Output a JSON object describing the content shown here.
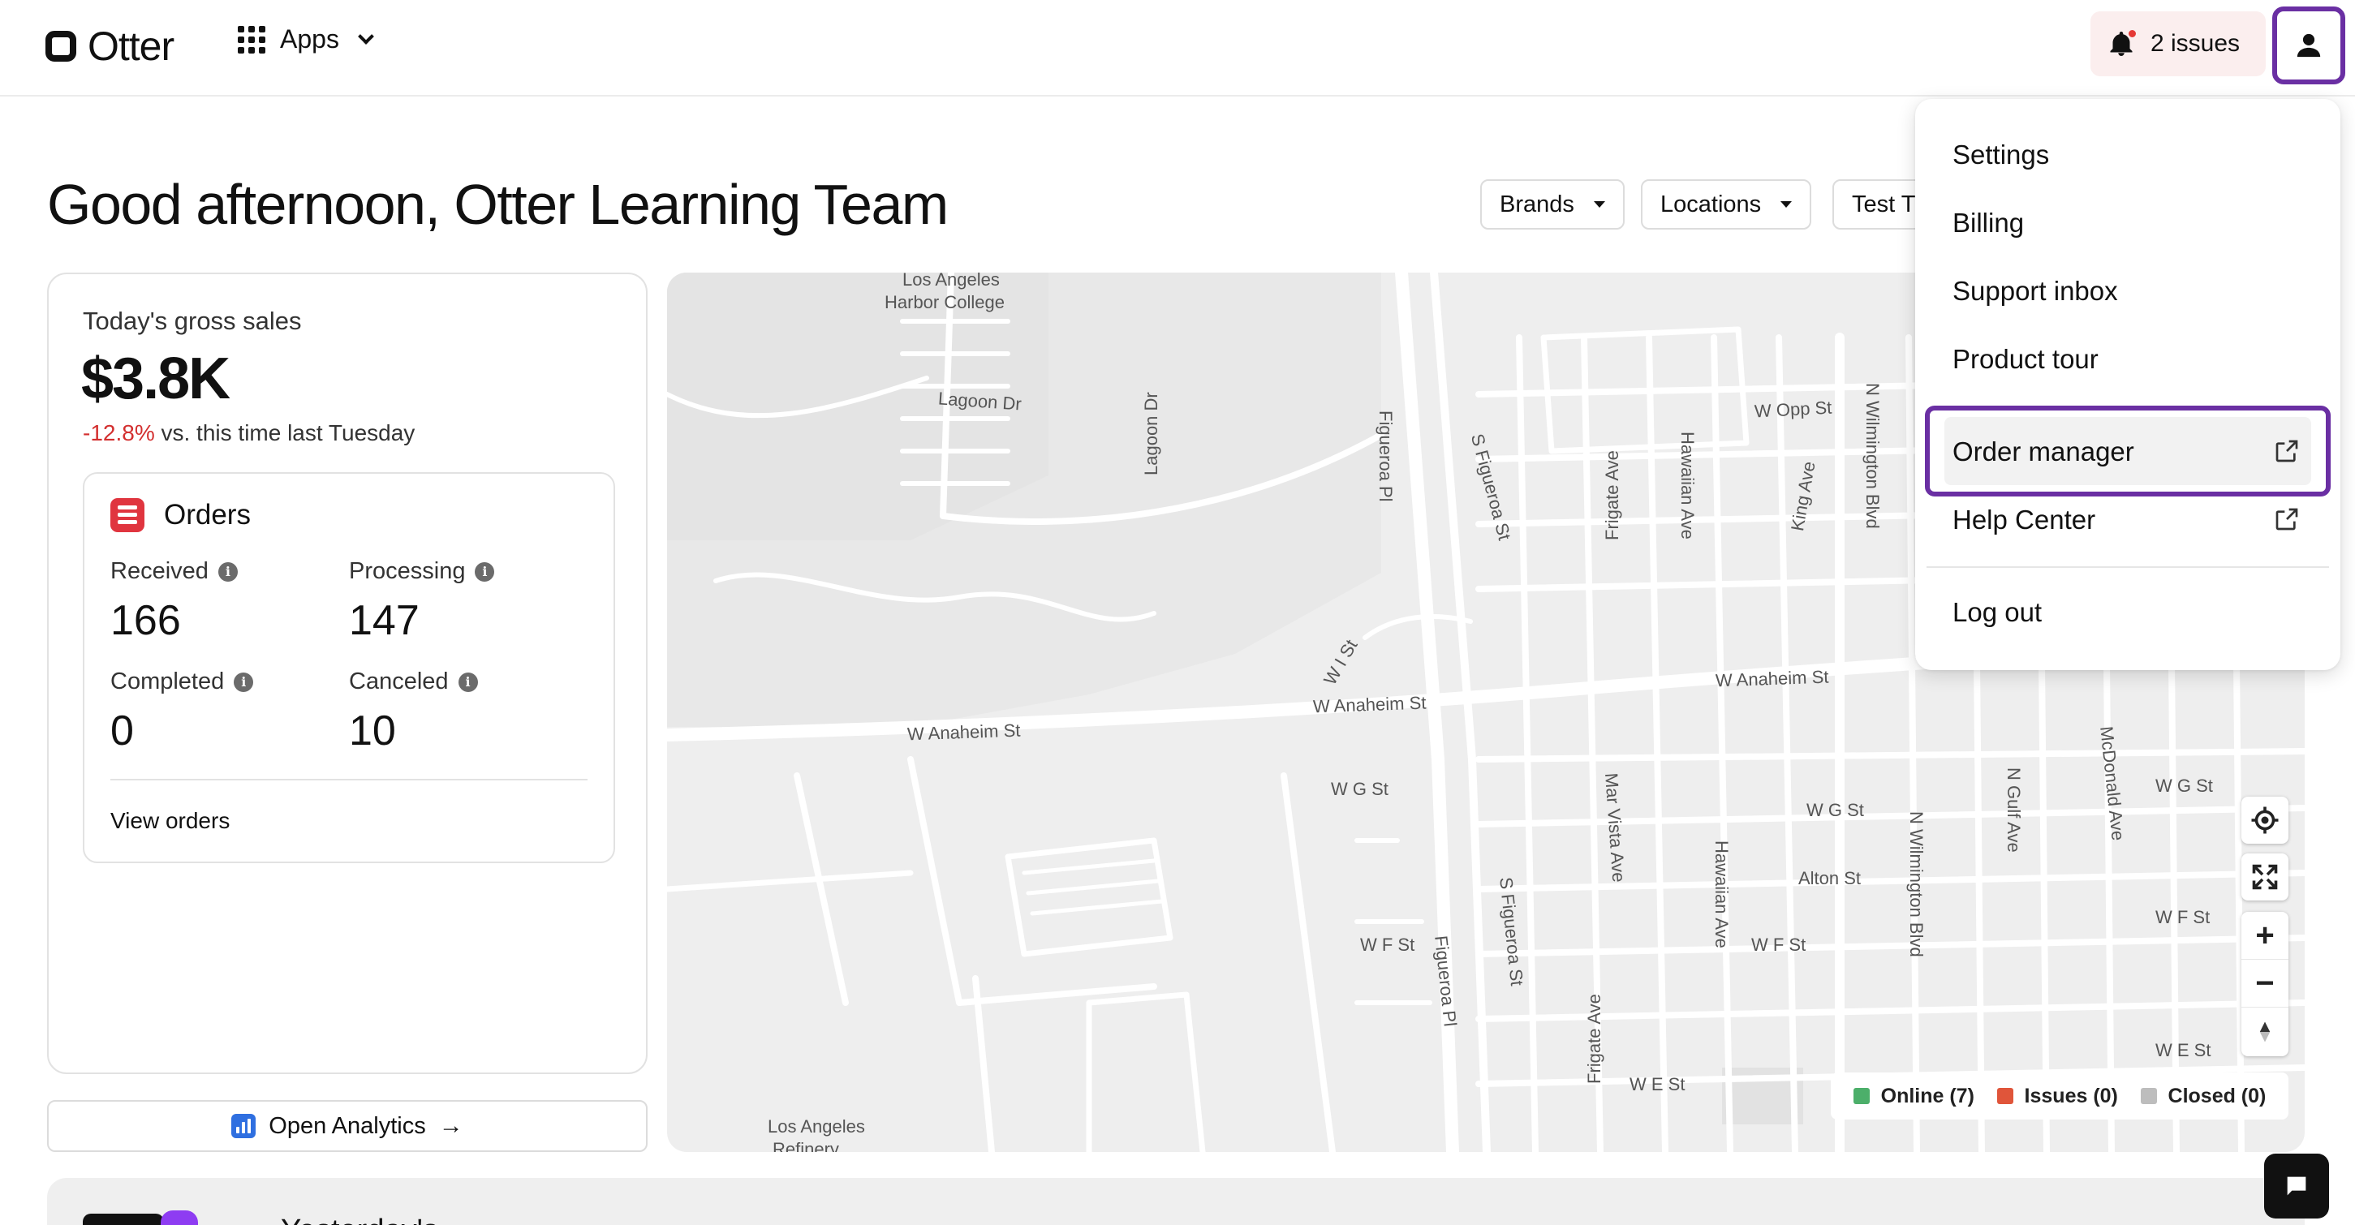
{
  "header": {
    "logo_text": "Otter",
    "apps_label": "Apps",
    "issues_label": "2 issues"
  },
  "greeting": "Good afternoon, Otter Learning Team",
  "filters": {
    "brands": "Brands",
    "locations": "Locations",
    "test": "Test T"
  },
  "sales": {
    "label": "Today's gross sales",
    "value": "$3.8K",
    "delta": "-12.8%",
    "delta_suffix": "vs. this time last Tuesday"
  },
  "orders": {
    "title": "Orders",
    "received_label": "Received",
    "received_value": "166",
    "processing_label": "Processing",
    "processing_value": "147",
    "completed_label": "Completed",
    "completed_value": "0",
    "canceled_label": "Canceled",
    "canceled_value": "10",
    "view_orders": "View orders"
  },
  "analytics": {
    "label": "Open Analytics"
  },
  "map": {
    "labels": {
      "la_harbor_1": "Los Angeles",
      "la_harbor_2": "Harbor College",
      "lagoon_dr": "Lagoon Dr",
      "lagoon_dr_v": "Lagoon Dr",
      "figueroa_pl": "Figueroa Pl",
      "s_figueroa_st": "S Figueroa St",
      "frigate_ave": "Frigate Ave",
      "hawaiian_ave": "Hawaiian Ave",
      "king_ave": "King Ave",
      "w_opp_st": "W Opp St",
      "n_wilmington": "N Wilmington Blvd",
      "w_i_st": "W I St",
      "w_anaheim_1": "W Anaheim St",
      "w_anaheim_2": "W Anaheim St",
      "w_anaheim_3": "W Anaheim St",
      "w_g_st_1": "W G St",
      "w_g_st_2": "W G St",
      "w_g_st_3": "W G St",
      "mar_vista": "Mar Vista Ave",
      "hawaiian_ave_2": "Hawaiian Ave",
      "n_wilmington_2": "N Wilmington Blvd",
      "n_gulf": "N Gulf Ave",
      "mcdonald": "McDonald Ave",
      "alton_st": "Alton St",
      "w_f_st_1": "W F St",
      "w_f_st_2": "W F St",
      "w_f_st_3": "W F St",
      "figueroa_pl_2": "Figueroa Pl",
      "s_figueroa_2": "S Figueroa St",
      "frigate_ave_2": "Frigate Ave",
      "w_e_st_1": "W E St",
      "w_e_st_2": "W E St",
      "la_refinery_1": "Los Angeles",
      "la_refinery_2": "Refinery"
    },
    "legend": {
      "online": "Online (7)",
      "issues": "Issues (0)",
      "closed": "Closed (0)",
      "online_color": "#4caf6a",
      "issues_color": "#e0553a",
      "closed_color": "#bdbdbd"
    }
  },
  "bottom": {
    "text": "Yesterday's"
  },
  "menu": {
    "settings": "Settings",
    "billing": "Billing",
    "support_inbox": "Support inbox",
    "product_tour": "Product tour",
    "order_manager": "Order manager",
    "help_center": "Help Center",
    "log_out": "Log out"
  },
  "colors": {
    "accent_highlight": "#6a2fa3",
    "negative": "#d32f2f",
    "issues_bg": "#fbeeee"
  }
}
